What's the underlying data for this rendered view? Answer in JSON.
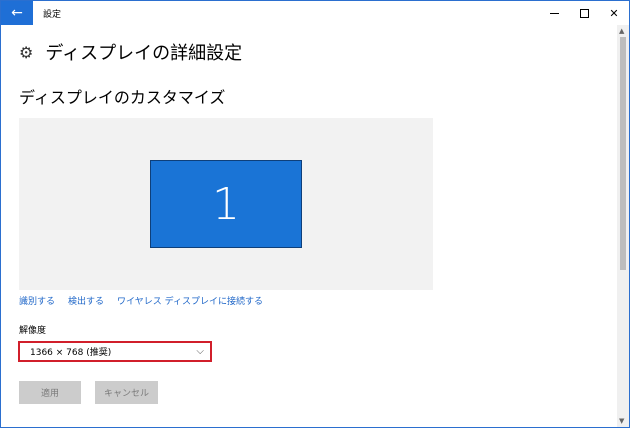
{
  "titlebar": {
    "back_icon": "←",
    "app_title": "設定",
    "close_glyph": "✕"
  },
  "header": {
    "gear_icon": "⚙",
    "title": "ディスプレイの詳細設定"
  },
  "section": {
    "title": "ディスプレイのカスタマイズ"
  },
  "display": {
    "monitor_number": "1",
    "accent_color": "#1a74d6"
  },
  "links": {
    "identify": "識別する",
    "detect": "検出する",
    "wireless": "ワイヤレス ディスプレイに接続する"
  },
  "resolution": {
    "label": "解像度",
    "value": "1366 × 768 (推奨)",
    "highlight_color": "#d11f2b"
  },
  "buttons": {
    "apply": "適用",
    "cancel": "キャンセル"
  },
  "scrollbar": {
    "up_icon": "▲",
    "down_icon": "▼"
  }
}
